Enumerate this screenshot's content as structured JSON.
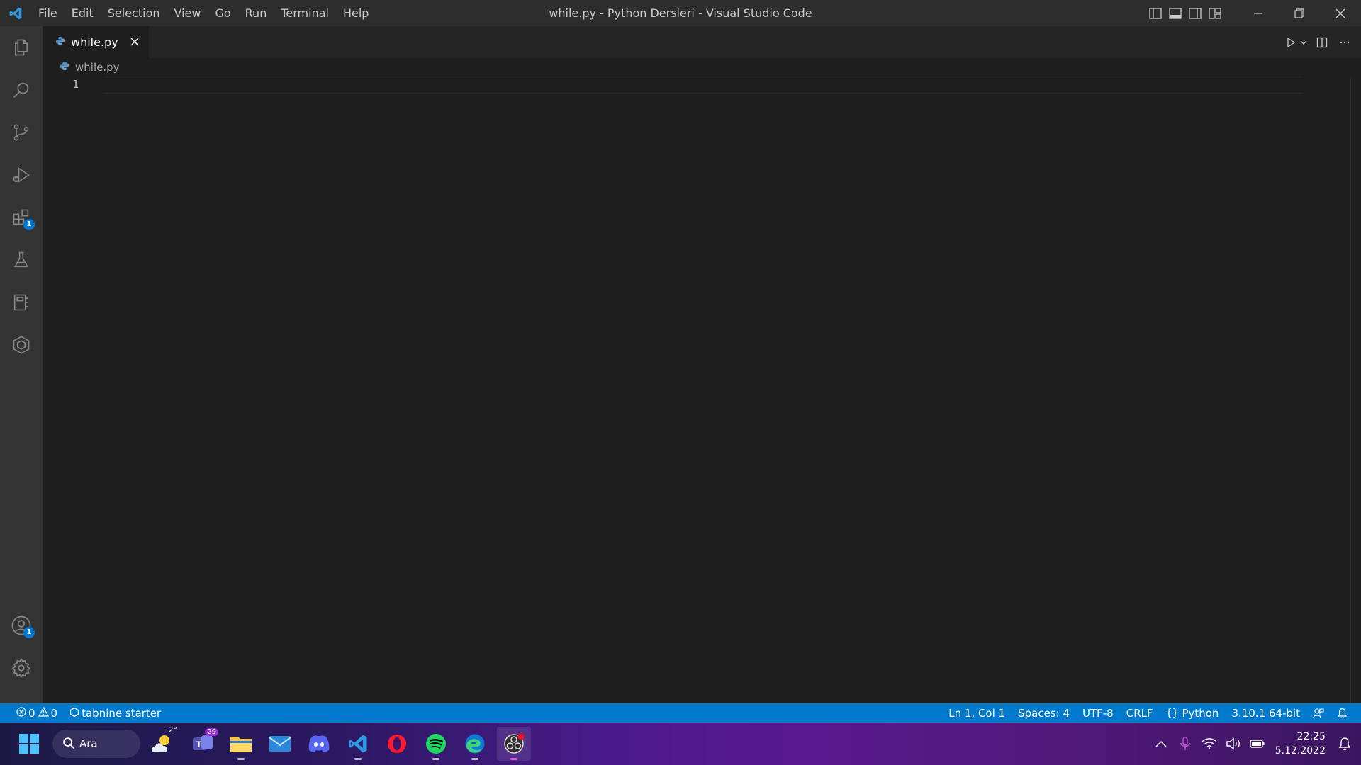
{
  "window": {
    "title": "while.py - Python Dersleri - Visual Studio Code",
    "menu": [
      "File",
      "Edit",
      "Selection",
      "View",
      "Go",
      "Run",
      "Terminal",
      "Help"
    ]
  },
  "activity_bar": {
    "items": [
      "explorer-icon",
      "search-icon",
      "source-control-icon",
      "run-debug-icon",
      "extensions-icon",
      "testing-icon",
      "remote-explorer-icon",
      "tabnine-hub-icon"
    ],
    "extensions_badge": "1",
    "accounts_badge": "1"
  },
  "tabs": [
    {
      "label": "while.py",
      "active": true
    }
  ],
  "breadcrumb": {
    "file": "while.py"
  },
  "editor": {
    "line_numbers": [
      "1"
    ]
  },
  "status_bar": {
    "errors": "0",
    "warnings": "0",
    "tabnine": "tabnine starter",
    "position": "Ln 1, Col 1",
    "spaces": "Spaces: 4",
    "encoding": "UTF-8",
    "eol": "CRLF",
    "language": "Python",
    "interpreter": "3.10.1 64-bit"
  },
  "taskbar": {
    "search_label": "Ara",
    "weather_temp": "2°",
    "teams_badge": "29",
    "time": "22:25",
    "date": "5.12.2022"
  },
  "colors": {
    "accent": "#007acc",
    "editor_bg": "#1e1e1e",
    "activity_bar_bg": "#333333",
    "title_bar_bg": "#2d2d2d"
  }
}
